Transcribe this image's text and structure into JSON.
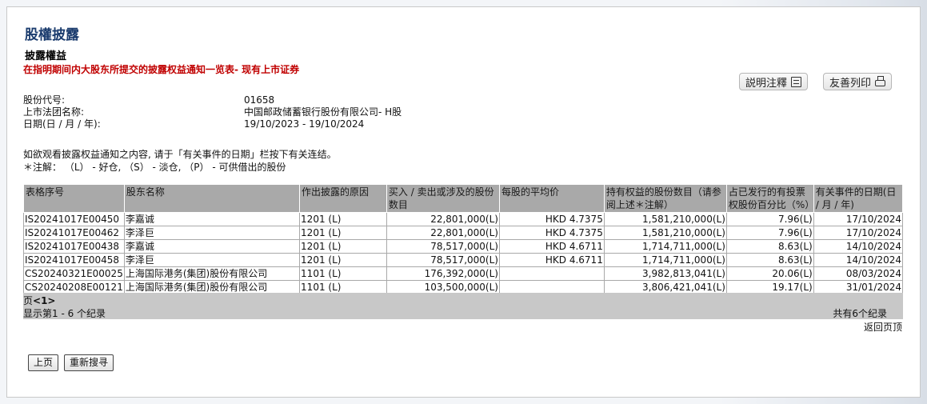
{
  "page": {
    "title": "股權披露",
    "subtitle": "披露權益",
    "notice": "在指明期间内大股东所提交的披露权益通知一览表- 现有上市证券"
  },
  "buttons": {
    "notes": "説明注釋",
    "print": "友善列印",
    "prev": "上页",
    "research": "重新搜寻",
    "back_top": "返回页顶"
  },
  "info": {
    "stock_code_label": "股份代号:",
    "stock_code": "01658",
    "company_label": "上市法团名称:",
    "company": "中国邮政储蓄银行股份有限公司- H股",
    "date_label": "日期(日 / 月 / 年):",
    "date_range": "19/10/2023 - 19/10/2024"
  },
  "description": {
    "line1": "如欲观看披露权益通知之内容, 请于「有关事件的日期」栏按下有关连结。",
    "line2": "＊注解： （L） - 好仓, （S） - 淡仓, （P） - 可供借出的股份"
  },
  "table": {
    "headers": [
      "表格序号",
      "股东名称",
      "作出披露的原因",
      "买入 / 卖出或涉及的股份数目",
      "每股的平均价",
      "持有权益的股份数目（请参阅上述＊注解）",
      "占已发行的有投票权股份百分比（%）",
      "有关事件的日期(日 / 月 / 年)"
    ],
    "rows": [
      [
        "IS20241017E00450",
        "李嘉诚",
        "1201 (L)",
        "22,801,000(L)",
        "HKD 4.7375",
        "1,581,210,000(L)",
        "7.96(L)",
        "17/10/2024"
      ],
      [
        "IS20241017E00462",
        "李泽巨",
        "1201 (L)",
        "22,801,000(L)",
        "HKD 4.7375",
        "1,581,210,000(L)",
        "7.96(L)",
        "17/10/2024"
      ],
      [
        "IS20241017E00438",
        "李嘉诚",
        "1201 (L)",
        "78,517,000(L)",
        "HKD 4.6711",
        "1,714,711,000(L)",
        "8.63(L)",
        "14/10/2024"
      ],
      [
        "IS20241017E00458",
        "李泽巨",
        "1201 (L)",
        "78,517,000(L)",
        "HKD 4.6711",
        "1,714,711,000(L)",
        "8.63(L)",
        "14/10/2024"
      ],
      [
        "CS20240321E00025",
        "上海国际港务(集团)股份有限公司",
        "1101 (L)",
        "176,392,000(L)",
        "",
        "3,982,813,041(L)",
        "20.06(L)",
        "08/03/2024"
      ],
      [
        "CS20240208E00121",
        "上海国际港务(集团)股份有限公司",
        "1101 (L)",
        "103,500,000(L)",
        "",
        "3,806,421,041(L)",
        "19.17(L)",
        "31/01/2024"
      ]
    ]
  },
  "pager": {
    "page_prefix": "页",
    "page_current": "<1>",
    "display": "显示第1 - 6 个纪录",
    "total": "共有6个纪录"
  }
}
